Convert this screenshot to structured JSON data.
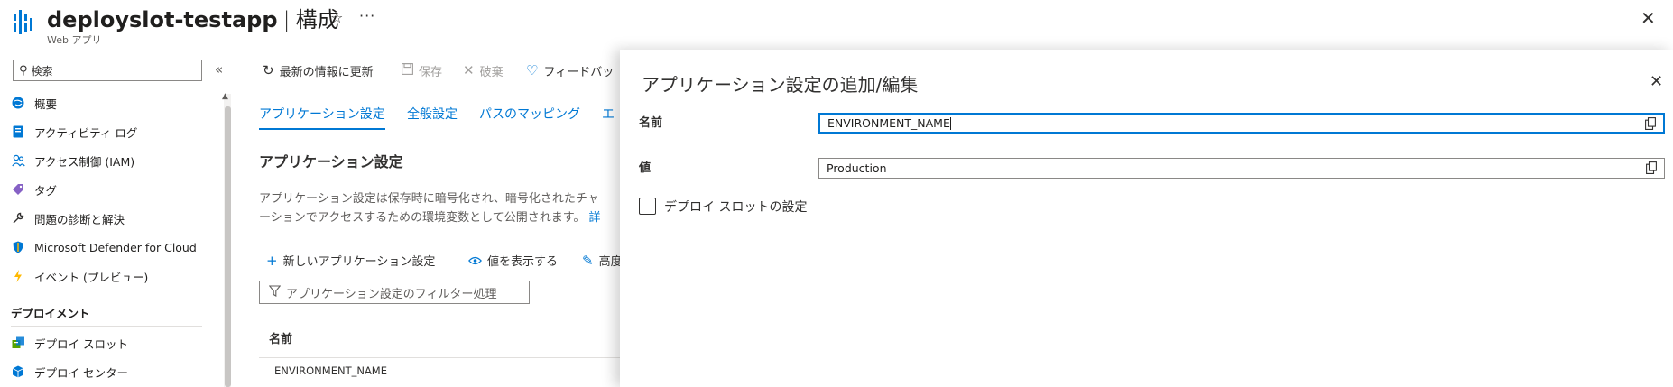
{
  "header": {
    "resource_name": "deployslot-testapp",
    "separator": "|",
    "page_name": "構成",
    "subtitle": "Web アプリ",
    "favorite_icon": "☆",
    "more_icon": "···",
    "close_icon": "✕"
  },
  "sidebar": {
    "search_placeholder": "検索",
    "collapse_icon": "«",
    "items": [
      {
        "label": "概要",
        "icon": "globe-icon",
        "color": "#0078d4"
      },
      {
        "label": "アクティビティ ログ",
        "icon": "log-icon",
        "color": "#0078d4"
      },
      {
        "label": "アクセス制御 (IAM)",
        "icon": "people-icon",
        "color": "#0078d4"
      },
      {
        "label": "タグ",
        "icon": "tag-icon",
        "color": "#8661c5"
      },
      {
        "label": "問題の診断と解決",
        "icon": "wrench-icon",
        "color": "#323130"
      },
      {
        "label": "Microsoft Defender for Cloud",
        "icon": "shield-icon",
        "color": "#0078d4"
      },
      {
        "label": "イベント (プレビュー)",
        "icon": "lightning-icon",
        "color": "#ffb900"
      }
    ],
    "section_title": "デプロイメント",
    "section_items": [
      {
        "label": "デプロイ スロット",
        "icon": "slots-icon",
        "color": "#57a300"
      },
      {
        "label": "デプロイ センター",
        "icon": "cube-icon",
        "color": "#0078d4"
      }
    ]
  },
  "toolbar": {
    "refresh": "最新の情報に更新",
    "save": "保存",
    "discard": "破棄",
    "feedback": "フィードバッ"
  },
  "tabs": [
    {
      "label": "アプリケーション設定",
      "active": true
    },
    {
      "label": "全般設定",
      "active": false
    },
    {
      "label": "パスのマッピング",
      "active": false
    },
    {
      "label": "エ",
      "active": false
    }
  ],
  "main": {
    "section_title": "アプリケーション設定",
    "description_line1": "アプリケーション設定は保存時に暗号化され、暗号化されたチャ",
    "description_line2": "ーションでアクセスするための環境変数として公開されます。",
    "description_link": "詳",
    "commands": {
      "new_setting": "新しいアプリケーション設定",
      "show_values": "値を表示する",
      "advanced": "高度"
    },
    "filter_placeholder": "アプリケーション設定のフィルター処理",
    "table": {
      "column_name": "名前",
      "rows": [
        "ENVIRONMENT_NAME"
      ]
    }
  },
  "panel": {
    "title": "アプリケーション設定の追加/編集",
    "close_icon": "✕",
    "name_label": "名前",
    "name_value": "ENVIRONMENT_NAME",
    "value_label": "値",
    "value_value": "Production",
    "slot_setting_label": "デプロイ スロットの設定",
    "slot_setting_checked": false
  },
  "colors": {
    "accent": "#0078d4",
    "text": "#323130"
  }
}
